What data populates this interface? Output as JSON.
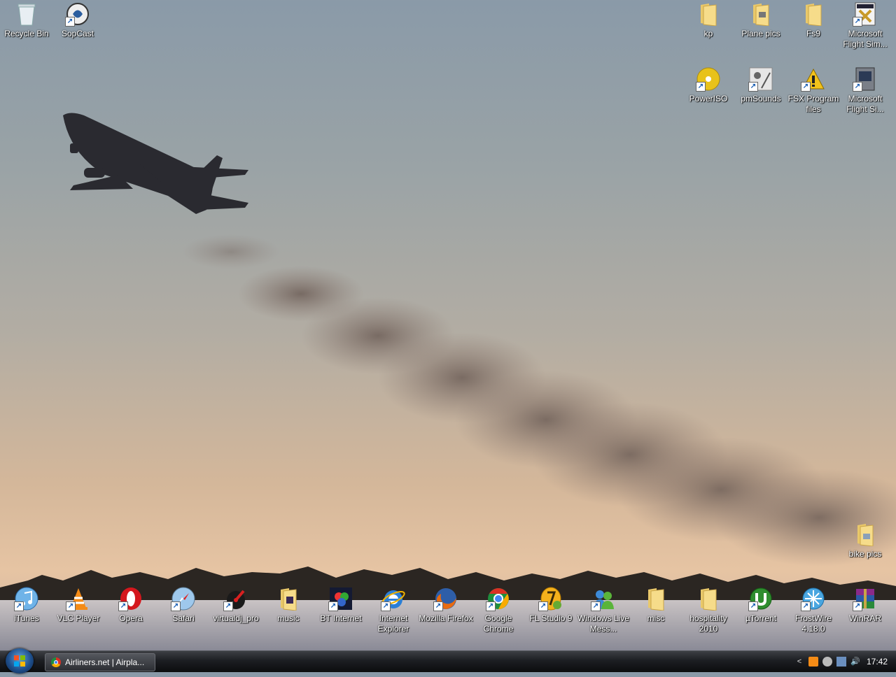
{
  "desktop": {
    "icons_top_left": [
      {
        "name": "recycle-bin-icon",
        "label": "Recycle Bin"
      },
      {
        "name": "sopcast-icon",
        "label": "SopCast"
      }
    ],
    "icons_top_right_row1": [
      {
        "name": "folder-icon",
        "label": "kp"
      },
      {
        "name": "folder-icon",
        "label": "Plane pics"
      },
      {
        "name": "folder-icon",
        "label": "Fs9"
      },
      {
        "name": "flight-sim-icon",
        "label": "Microsoft Flight Sim..."
      }
    ],
    "icons_top_right_row2": [
      {
        "name": "poweriso-icon",
        "label": "PowerISO"
      },
      {
        "name": "pmsounds-icon",
        "label": "pmSounds"
      },
      {
        "name": "warning-icon",
        "label": "FSX Program files"
      },
      {
        "name": "flight-sim-icon",
        "label": "Microsoft Flight Si..."
      }
    ],
    "icon_right_single": {
      "name": "folder-icon",
      "label": "bike pics"
    },
    "icons_bottom_row": [
      {
        "name": "itunes-icon",
        "label": "iTunes"
      },
      {
        "name": "vlc-icon",
        "label": "VLC Player"
      },
      {
        "name": "opera-icon",
        "label": "Opera"
      },
      {
        "name": "safari-icon",
        "label": "Safari"
      },
      {
        "name": "virtualdj-icon",
        "label": "virtualdj_pro"
      },
      {
        "name": "folder-icon",
        "label": "music"
      },
      {
        "name": "bt-internet-icon",
        "label": "BT Internet"
      },
      {
        "name": "internet-explorer-icon",
        "label": "Internet Explorer"
      },
      {
        "name": "firefox-icon",
        "label": "Mozilla Firefox"
      },
      {
        "name": "chrome-icon",
        "label": "Google Chrome"
      },
      {
        "name": "fl-studio-icon",
        "label": "FL Studio 9"
      },
      {
        "name": "live-messenger-icon",
        "label": "Windows Live Mess..."
      },
      {
        "name": "folder-icon",
        "label": "misc"
      },
      {
        "name": "folder-icon",
        "label": "hospitality 2010"
      },
      {
        "name": "utorrent-icon",
        "label": "µTorrent"
      },
      {
        "name": "frostwire-icon",
        "label": "FrostWire 4.18.0"
      },
      {
        "name": "winrar-icon",
        "label": "WinRAR"
      }
    ]
  },
  "taskbar": {
    "task_button_label": "Airliners.net | Airpla...",
    "tray_chevron": "<",
    "clock": "17:42"
  }
}
